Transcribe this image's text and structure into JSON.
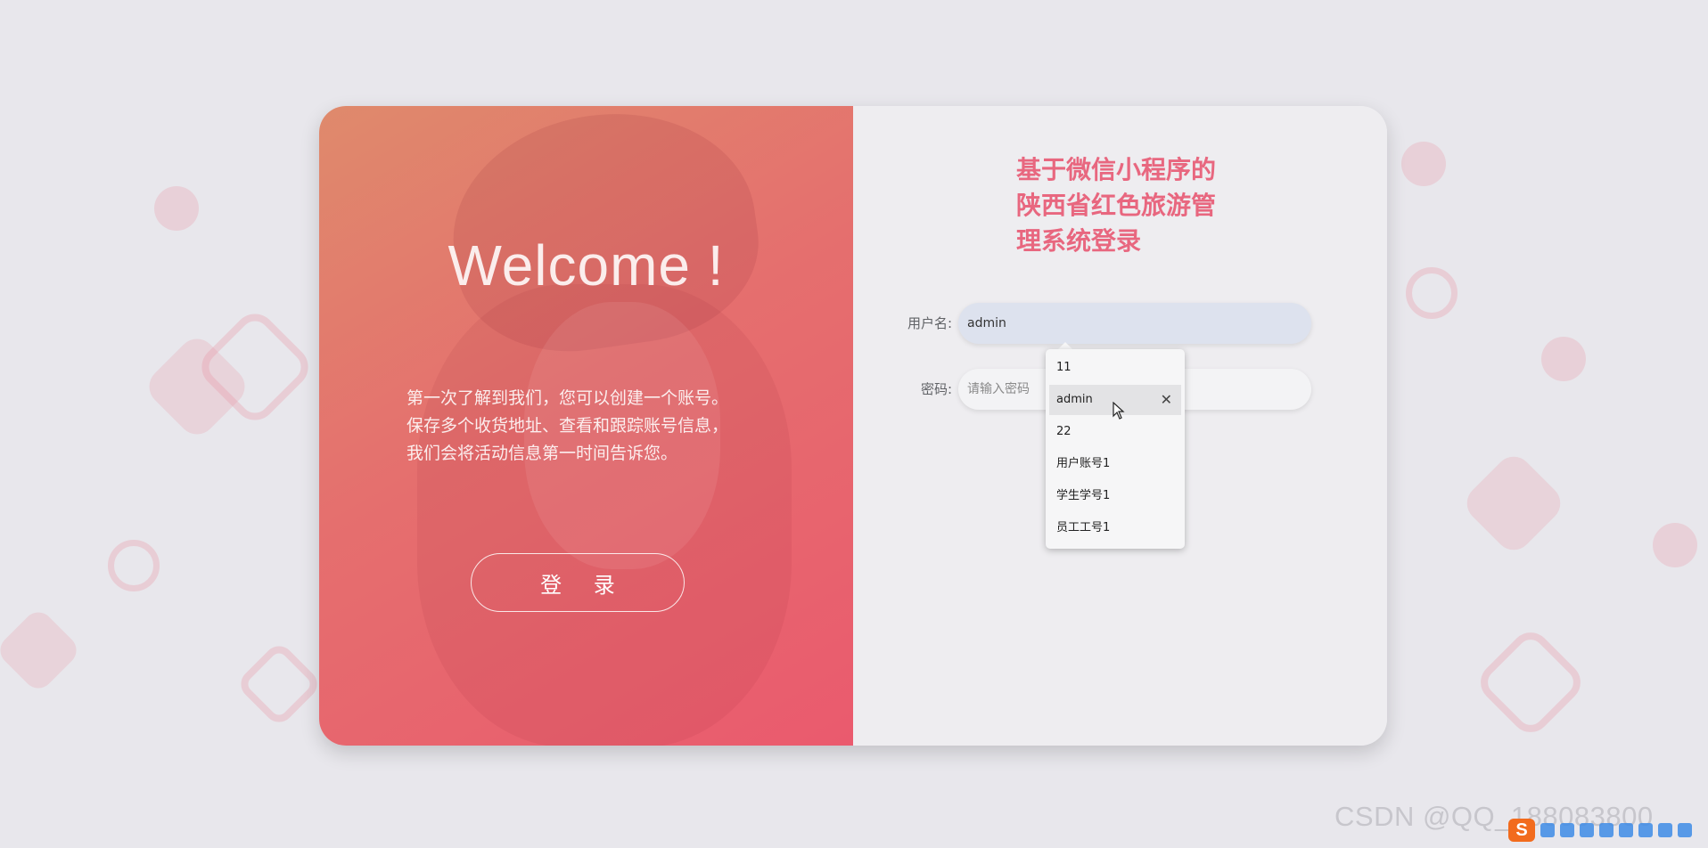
{
  "welcome": {
    "heading": "Welcome !",
    "intro_lines": [
      "第一次了解到我们，您可以创建一个账号。",
      "保存多个收货地址、查看和跟踪账号信息，",
      "我们会将活动信息第一时间告诉您。"
    ],
    "login_label": "登 录"
  },
  "login_form": {
    "title_lines": [
      "基于微信小程序的",
      "陕西省红色旅游管",
      "理系统登录"
    ],
    "username": {
      "label": "用户名:",
      "value": "admin"
    },
    "password": {
      "label": "密码:",
      "placeholder": "请输入密码"
    }
  },
  "autocomplete": {
    "items": [
      "11",
      "admin",
      "22",
      "用户账号1",
      "学生学号1",
      "员工工号1"
    ],
    "hovered_index": 1,
    "remove_symbol": "✕"
  },
  "watermark": "CSDN @QQ_188083800",
  "ime": {
    "logo": "S"
  },
  "colors": {
    "accent": "#e8677f",
    "left_panel_start": "#df8a6c",
    "left_panel_end": "#ea5a6e",
    "background": "#e8e7ec"
  }
}
